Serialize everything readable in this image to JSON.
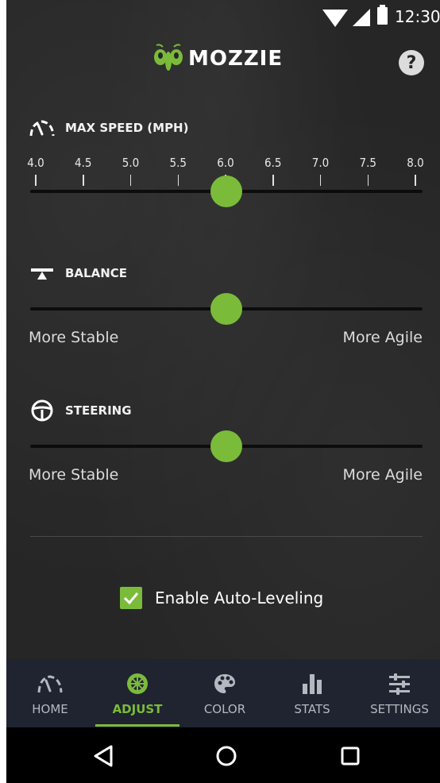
{
  "status_bar": {
    "time": "12:30",
    "icons": [
      "wifi-icon",
      "signal-icon",
      "battery-icon"
    ]
  },
  "header": {
    "brand": "MOZZIE",
    "logo_icon": "mantis-icon",
    "help_label": "?"
  },
  "max_speed": {
    "title": "MAX SPEED (MPH)",
    "icon": "speedometer-icon",
    "ticks": [
      "4.0",
      "4.5",
      "5.0",
      "5.5",
      "6.0",
      "6.5",
      "7.0",
      "7.5",
      "8.0"
    ],
    "min": 4.0,
    "max": 8.0,
    "value": 6.0
  },
  "balance": {
    "title": "BALANCE",
    "icon": "balance-board-icon",
    "left_label": "More Stable",
    "right_label": "More Agile",
    "value_fraction": 0.5
  },
  "steering": {
    "title": "STEERING",
    "icon": "steering-wheel-icon",
    "left_label": "More Stable",
    "right_label": "More Agile",
    "value_fraction": 0.5
  },
  "auto_leveling": {
    "label": "Enable Auto-Leveling",
    "checked": true
  },
  "bottom_nav": {
    "items": [
      {
        "label": "HOME",
        "icon": "speedometer-icon",
        "active": false
      },
      {
        "label": "ADJUST",
        "icon": "wheel-icon",
        "active": true
      },
      {
        "label": "COLOR",
        "icon": "palette-icon",
        "active": false
      },
      {
        "label": "STATS",
        "icon": "bar-chart-icon",
        "active": false
      },
      {
        "label": "SETTINGS",
        "icon": "sliders-icon",
        "active": false
      }
    ]
  },
  "system_nav": {
    "icons": [
      "back-icon",
      "home-circle-icon",
      "recents-icon"
    ]
  },
  "colors": {
    "accent": "#7bbb3a",
    "background": "#262626",
    "nav_bg": "#1f2430"
  }
}
